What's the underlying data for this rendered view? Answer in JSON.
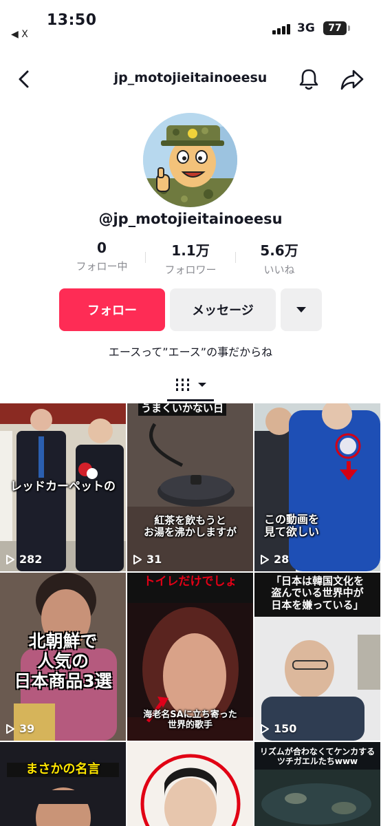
{
  "status": {
    "time": "13:50",
    "back_label": "◀ X",
    "network": "3G",
    "battery": "77"
  },
  "header": {
    "title": "jp_motojieitainoeesu"
  },
  "profile": {
    "handle": "@jp_motojieitainoeesu",
    "stats": [
      {
        "value": "0",
        "label": "フォロー中"
      },
      {
        "value": "1.1万",
        "label": "フォロワー"
      },
      {
        "value": "5.6万",
        "label": "いいね"
      }
    ],
    "follow_label": "フォロー",
    "message_label": "メッセージ",
    "bio": "エースって”エース”の事だからね"
  },
  "colors": {
    "accent": "#fe2c55",
    "secondary_btn": "#efeff0",
    "text": "#161823",
    "muted": "#8a8b91"
  },
  "icons": {
    "back": "chevron-left-icon",
    "bell": "bell-icon",
    "share": "share-arrow-icon",
    "more": "caret-down-icon",
    "tab": "grid-filter-icon",
    "play": "play-icon"
  },
  "videos": [
    {
      "caption": "レッドカーペットの",
      "views": "282"
    },
    {
      "caption_top": "うまくいかない日",
      "caption": "紅茶を飲もうと\nお湯を沸かしますが",
      "views": "31"
    },
    {
      "caption": "この動画を\n見て欲しい",
      "views": "28"
    },
    {
      "caption": "北朝鮮で\n人気の\n日本商品3選",
      "views": "39"
    },
    {
      "caption_top": "トイレだけでしょ",
      "caption": "海老名SAに立ち寄った\n世界的歌手",
      "views": ""
    },
    {
      "caption_top": "「日本は韓国文化を\n盗んでいる世界中が\n日本を嫌っている」",
      "views": "150"
    },
    {
      "caption_top": "まさかの名言",
      "views": ""
    },
    {
      "caption_top": "",
      "views": ""
    },
    {
      "caption_top": "リズムが合わなくてケンカする\nツチガエルたちwww",
      "views": ""
    }
  ]
}
